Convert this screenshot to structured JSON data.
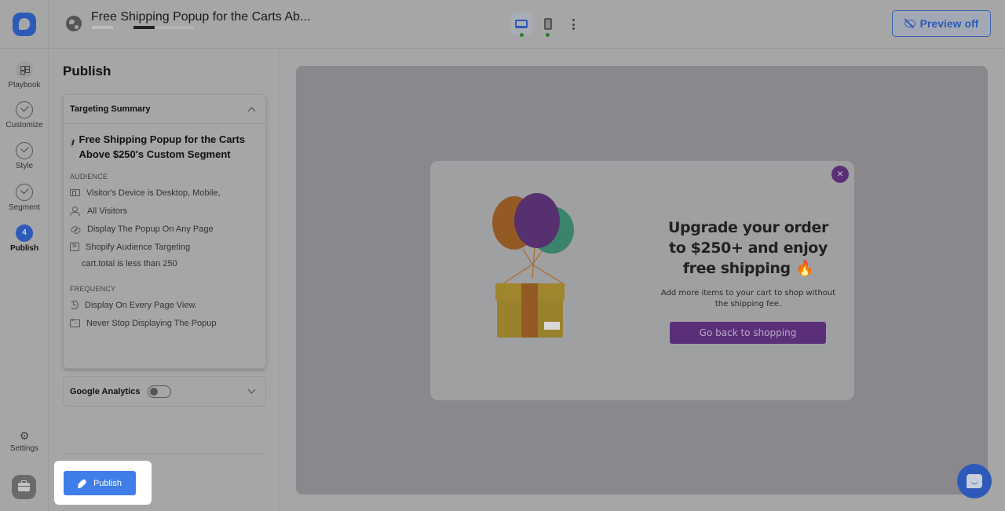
{
  "topbar": {
    "doc_title": "Free Shipping Popup for the Carts Ab...",
    "device_modes": [
      {
        "name": "desktop",
        "active": true,
        "status": "enabled"
      },
      {
        "name": "mobile",
        "active": false,
        "status": "enabled"
      }
    ],
    "preview_label": "Preview off",
    "accent_color": "#2d5ab8"
  },
  "nav": {
    "items": [
      {
        "label": "Playbook",
        "icon": "grid-icon",
        "state": "default"
      },
      {
        "label": "Customize",
        "icon": "check-circle-icon",
        "state": "completed"
      },
      {
        "label": "Style",
        "icon": "check-circle-icon",
        "state": "completed"
      },
      {
        "label": "Segment",
        "icon": "check-circle-icon",
        "state": "completed"
      },
      {
        "label": "Publish",
        "icon": "step-number",
        "step": "4",
        "state": "active"
      }
    ],
    "settings_label": "Settings"
  },
  "panel": {
    "title": "Publish",
    "targeting": {
      "header": "Targeting Summary",
      "segment_title": "Free Shipping Popup for the Carts Above $250's Custom Segment",
      "audience_label": "AUDIENCE",
      "audience_rules": [
        {
          "icon": "device-icon",
          "text": "Visitor's Device is Desktop, Mobile,"
        },
        {
          "icon": "users-icon",
          "text": "All Visitors"
        },
        {
          "icon": "link-icon",
          "text": "Display The Popup On Any Page"
        },
        {
          "icon": "shopify-bag-icon",
          "text": "Shopify Audience Targeting"
        }
      ],
      "audience_condition": "cart.total is less than 250",
      "frequency_label": "FREQUENCY",
      "frequency_rules": [
        {
          "icon": "history-icon",
          "text": "Display On Every Page View."
        },
        {
          "icon": "screen-icon",
          "text": "Never Stop Displaying The Popup"
        }
      ]
    },
    "google_analytics": {
      "label": "Google Analytics",
      "enabled": false
    },
    "publish_label": "Publish",
    "publish_color": "#3f7ee8"
  },
  "popup": {
    "headline": "Upgrade your order to $250+ and enjoy free shipping 🔥",
    "subtext": "Add more items to your cart to shop without the shipping fee.",
    "cta_label": "Go back to shopping",
    "close_label": "×",
    "brand_color": "#5a2f78"
  }
}
